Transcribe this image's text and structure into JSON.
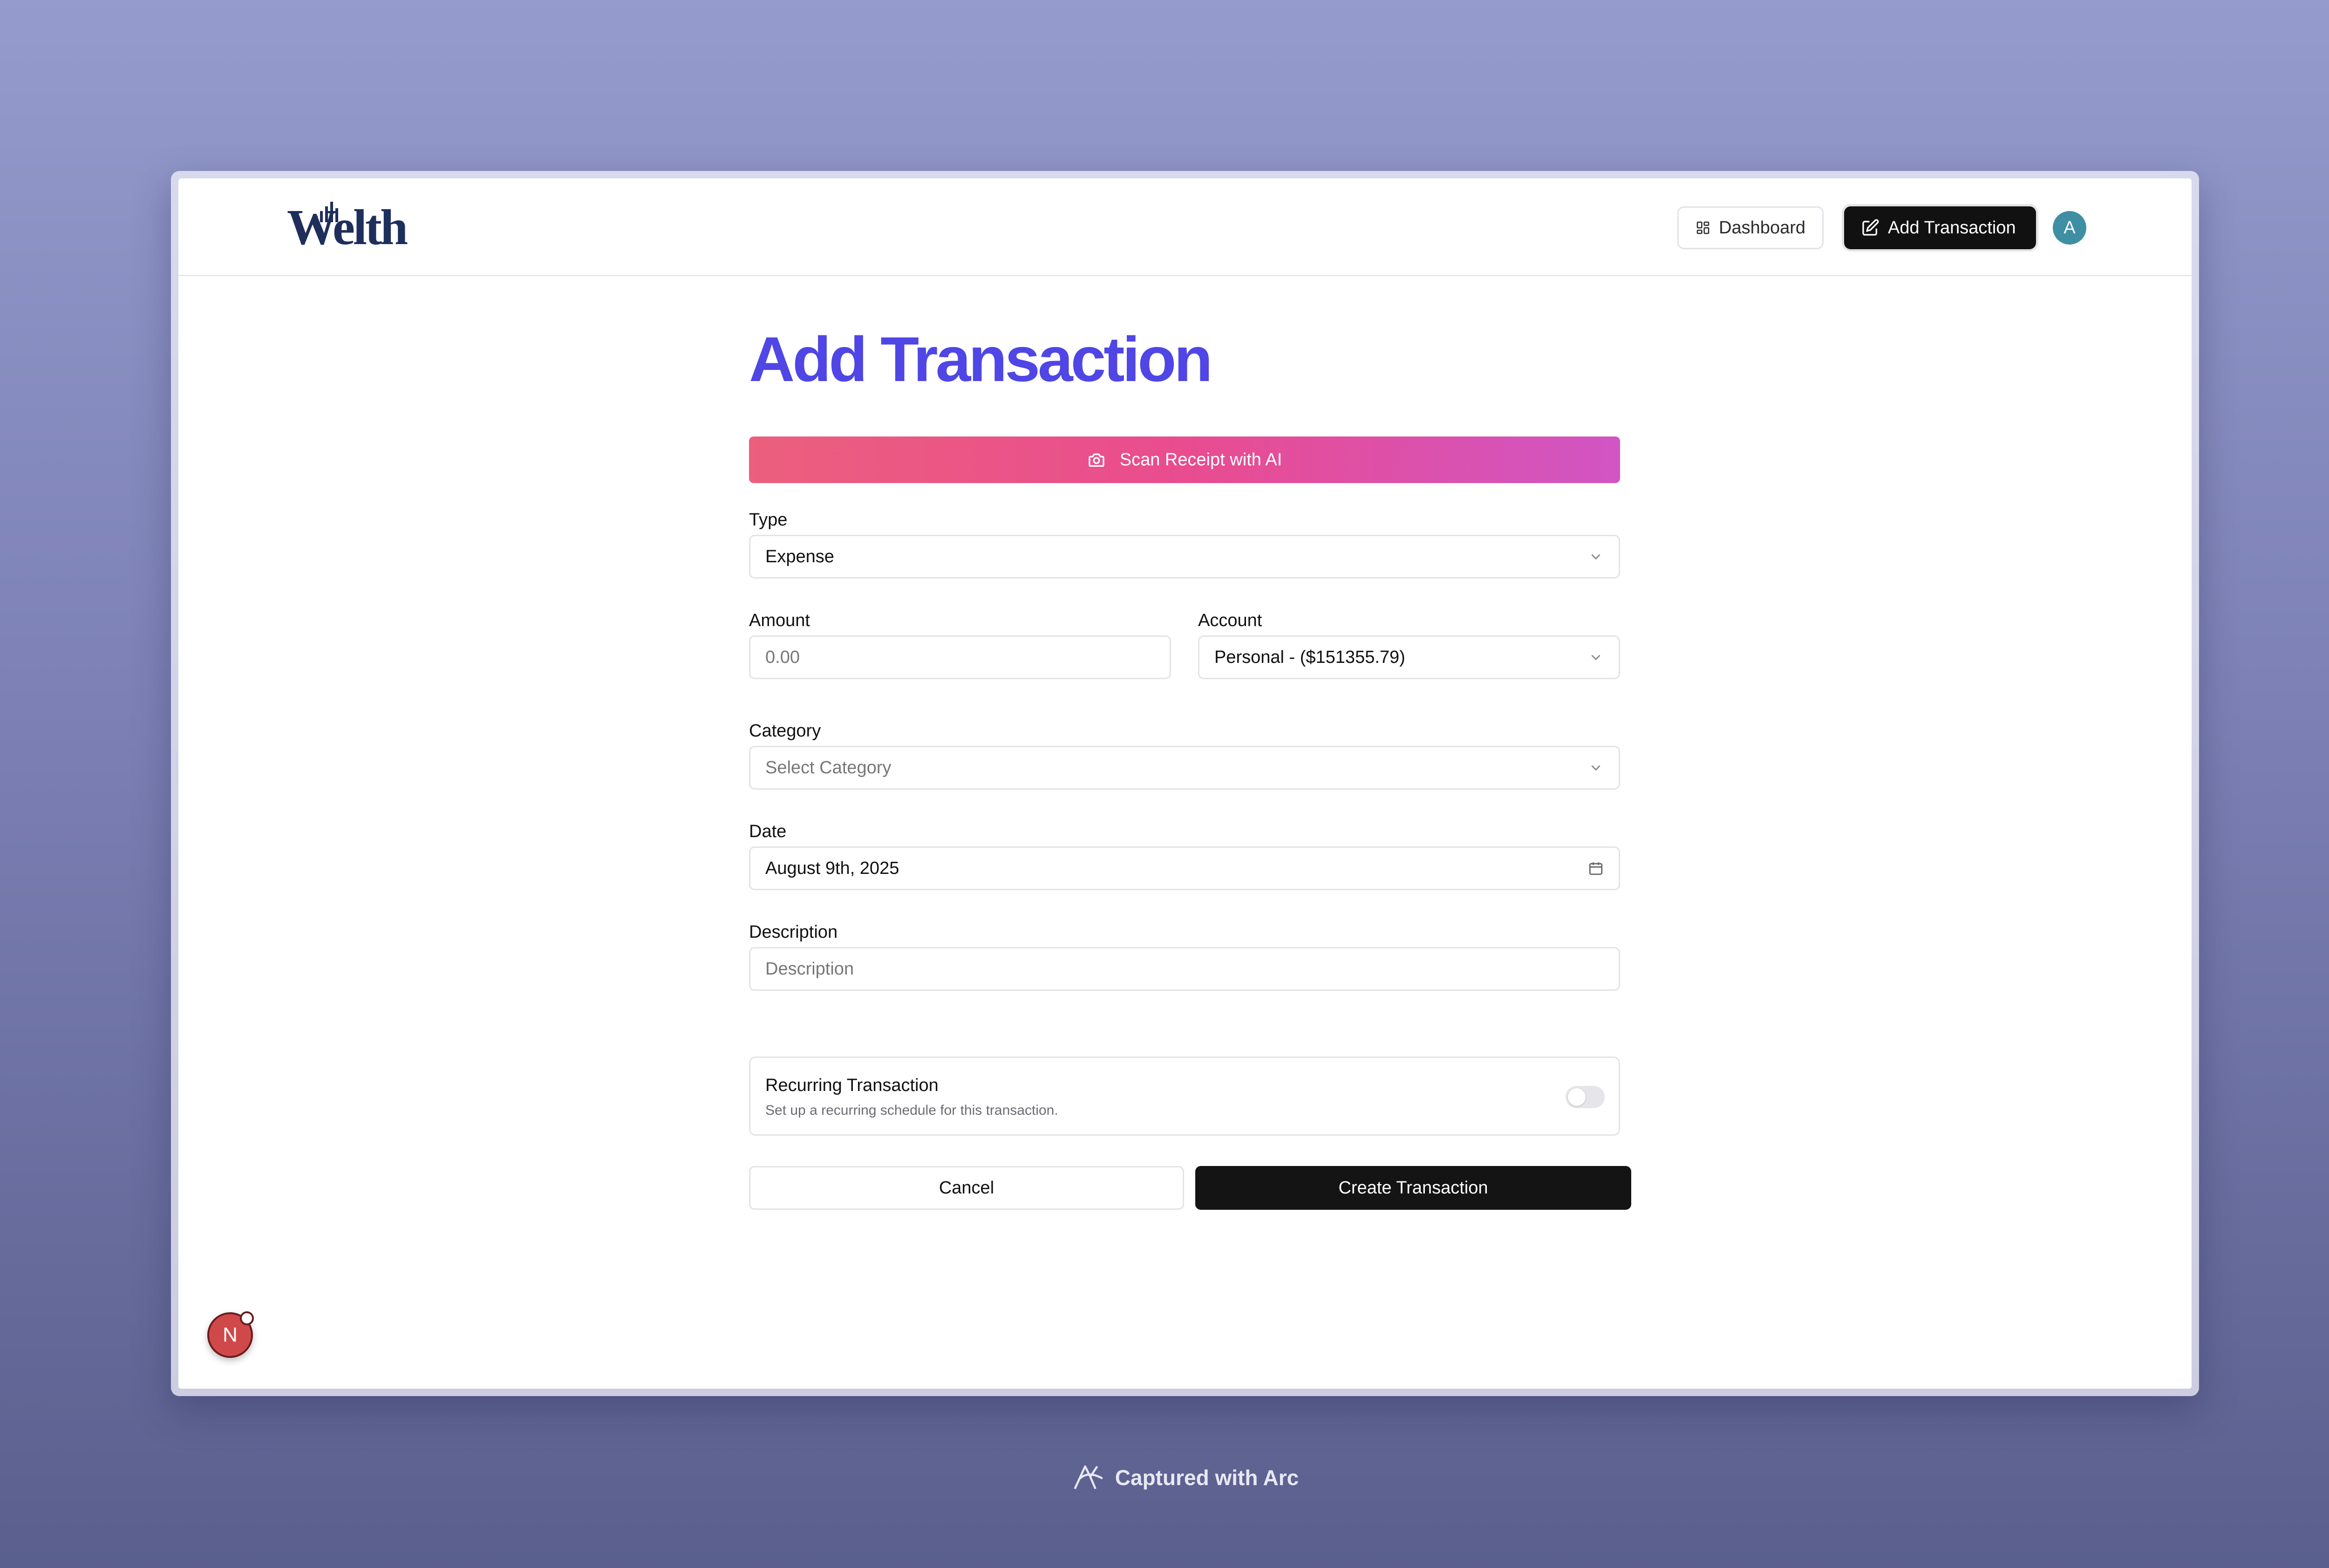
{
  "app": {
    "logo_text": "Welth"
  },
  "nav": {
    "dashboard_label": "Dashboard",
    "add_transaction_label": "Add Transaction",
    "avatar_initial": "A"
  },
  "page": {
    "title": "Add Transaction"
  },
  "scan": {
    "label": "Scan Receipt with AI"
  },
  "form": {
    "type_label": "Type",
    "type_value": "Expense",
    "amount_label": "Amount",
    "amount_placeholder": "0.00",
    "account_label": "Account",
    "account_value": "Personal - ($151355.79)",
    "category_label": "Category",
    "category_placeholder": "Select Category",
    "date_label": "Date",
    "date_value": "August 9th, 2025",
    "description_label": "Description",
    "description_placeholder": "Description",
    "recurring_title": "Recurring Transaction",
    "recurring_subtitle": "Set up a recurring schedule for this transaction.",
    "recurring_enabled": false,
    "cancel_label": "Cancel",
    "create_label": "Create Transaction"
  },
  "dev_badge": {
    "letter": "N"
  },
  "footer": {
    "text": "Captured with Arc"
  },
  "colors": {
    "title": "#4f46e5",
    "scan_gradient_start": "#ec5f7d",
    "scan_gradient_end": "#d155c4",
    "primary_button": "#141414",
    "avatar": "#3e8fa4"
  }
}
